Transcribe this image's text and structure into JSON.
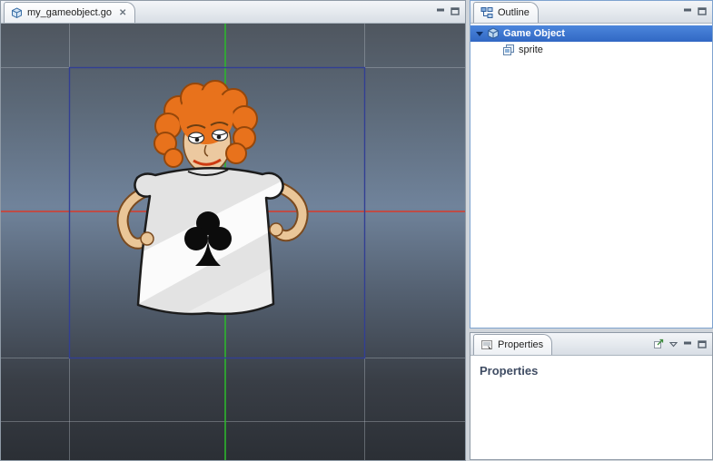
{
  "editor": {
    "tab": {
      "label": "my_gameobject.go",
      "close_glyph": "✕"
    }
  },
  "outline": {
    "tab_label": "Outline",
    "tree": {
      "root": {
        "label": "Game Object",
        "selected": true,
        "expanded": true,
        "icon": "game-object-cube-icon"
      },
      "child": {
        "label": "sprite",
        "selected": false,
        "icon": "sprite-icon"
      }
    }
  },
  "properties": {
    "tab_label": "Properties",
    "title": "Properties"
  },
  "icons": {
    "editor_tab": "game-object-cube-icon",
    "outline_tab": "outline-tree-icon",
    "properties_tab": "property-sheet-icon",
    "properties_toolbar": [
      "pin-view-icon",
      "view-menu-chevron-icon",
      "minimize-icon",
      "maximize-icon"
    ]
  },
  "colors": {
    "selection_highlight": "#3874d8",
    "axis_x": "#d93a2b",
    "axis_y": "#2db52d",
    "selection_box": "#323f93",
    "character_hair": "#e8721c"
  }
}
